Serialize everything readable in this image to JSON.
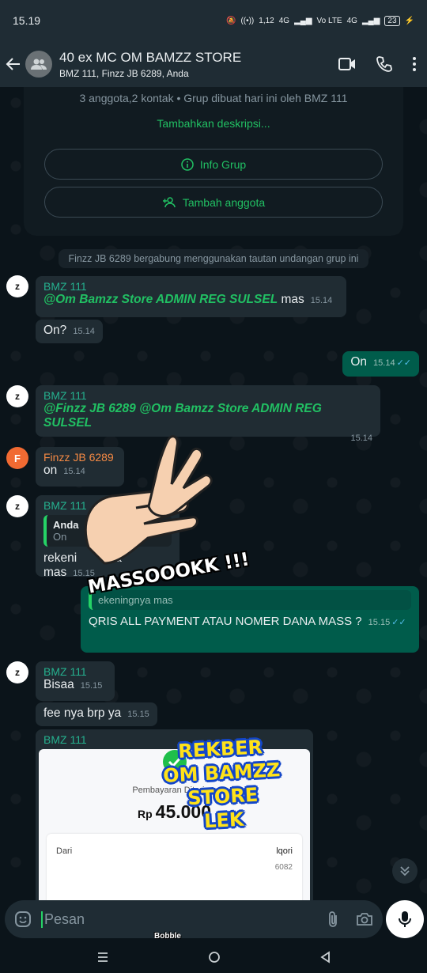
{
  "status": {
    "time": "15.19",
    "battery": "23",
    "net1": "1,12",
    "net2": "4G",
    "net3": "Vo LTE",
    "net4": "4G"
  },
  "header": {
    "title": "40 ex MC OM BAMZZ STORE",
    "subtitle": "BMZ 111, Finzz JB 6289, Anda"
  },
  "group_info": {
    "members_line": "3 anggota,2 kontak • Grup dibuat hari ini oleh BMZ 111",
    "add_description": "Tambahkan deskripsi...",
    "info_button": "Info Grup",
    "add_member_button": "Tambah anggota"
  },
  "system_message": "Finzz JB 6289 bergabung menggunakan tautan undangan grup ini",
  "messages": [
    {
      "sender": "BMZ 111",
      "mention": "@Om Bamzz Store ADMIN REG SULSEL",
      "text": " mas",
      "time": "15.14"
    },
    {
      "text": "On?",
      "time": "15.14"
    },
    {
      "text": "On",
      "time": "15.14"
    },
    {
      "sender": "BMZ 111",
      "mention": "@Finzz JB 6289 @Om Bamzz Store ADMIN REG SULSEL",
      "time": "15.14"
    },
    {
      "sender": "Finzz JB 6289",
      "text": "on",
      "time": "15.14"
    },
    {
      "sender": "BMZ 111",
      "quote_author": "Anda",
      "quote_text": "On",
      "text": "rekeni",
      "text_tail": "a mas",
      "time": "15.15"
    },
    {
      "quote_text": "ekeningnya mas",
      "text": "QRIS ALL PAYMENT ATAU NOMER DANA MASS ?",
      "time": "15.15"
    },
    {
      "sender": "BMZ 111",
      "text": "Bisaa",
      "time": "15.15"
    },
    {
      "text": "fee nya brp ya",
      "time": "15.15"
    },
    {
      "sender": "BMZ 111"
    }
  ],
  "receipt": {
    "status": "Pembayaran Diterima",
    "currency": "Rp",
    "amount": "45.000",
    "from_label": "Dari",
    "name_partial": "lqori",
    "number_partial": "6082"
  },
  "avatars": {
    "bmz": "z",
    "finzz": "F"
  },
  "stickers": {
    "massook": "MASSOOOKK !!!",
    "rekber": [
      "REKBER",
      "OM BAMZZ",
      "STORE",
      "LEK"
    ]
  },
  "input": {
    "placeholder": "Pesan"
  },
  "keyboard_brand": "Bobble",
  "colors": {
    "accent": "#21c063",
    "outgoing_bubble": "#005c4b",
    "incoming_bubble": "#202c33",
    "background": "#0b141a"
  }
}
